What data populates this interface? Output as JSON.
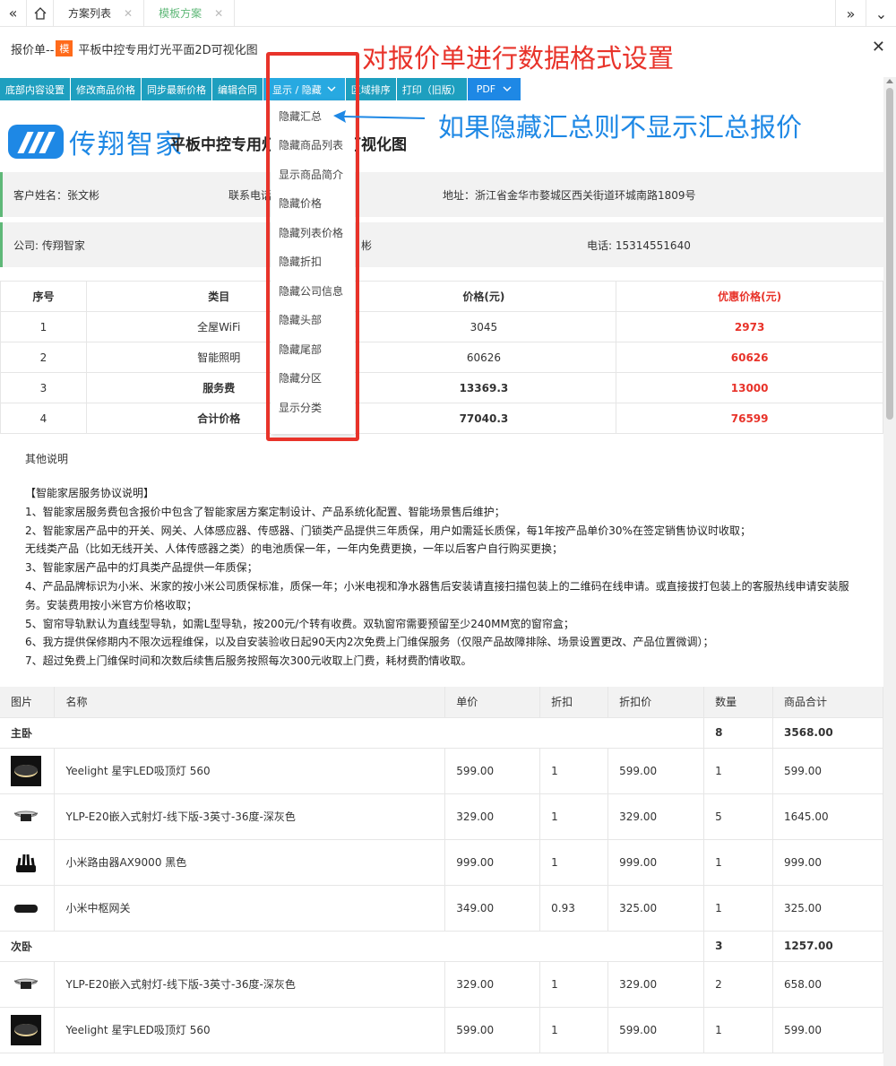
{
  "tabs": [
    {
      "label": "方案列表"
    },
    {
      "label": "模板方案"
    }
  ],
  "header": {
    "prefix": "报价单--",
    "badge": "模",
    "title": "平板中控专用灯光平面2D可视化图"
  },
  "toolbar": {
    "buttons": [
      "底部内容设置",
      "修改商品价格",
      "同步最新价格",
      "编辑合同",
      "显示 / 隐藏",
      "区域排序",
      "打印（旧版）",
      "PDF"
    ]
  },
  "brand": {
    "logo_text": "传翔智家",
    "doc_title": "平板中控专用灯光平面2D可视化图"
  },
  "info": {
    "customer": "客户姓名：张文彬",
    "contact": "联系电话：",
    "address": "地址：浙江省金华市婺城区西关街道环城南路1809号",
    "company": "公司: 传翔智家",
    "staff_suffix": "彬",
    "phone": "电话: 15314551640"
  },
  "summary": {
    "headers": [
      "序号",
      "类目",
      "价格(元)",
      "优惠价格(元)"
    ],
    "rows": [
      [
        "1",
        "全屋WiFi",
        "3045",
        "2973"
      ],
      [
        "2",
        "智能照明",
        "60626",
        "60626"
      ],
      [
        "3",
        "服务费",
        "13369.3",
        "13000"
      ],
      [
        "4",
        "合计价格",
        "77040.3",
        "76599"
      ]
    ]
  },
  "notes": {
    "title": "其他说明",
    "lines": [
      "【智能家居服务协议说明】",
      "1、智能家居服务费包含报价中包含了智能家居方案定制设计、产品系统化配置、智能场景售后维护；",
      "2、智能家居产品中的开关、网关、人体感应器、传感器、门锁类产品提供三年质保，用户如需延长质保，每1年按产品单价30%在签定销售协议时收取；",
      "无线类产品（比如无线开关、人体传感器之类）的电池质保一年，一年内免费更换，一年以后客户自行购买更换；",
      "3、智能家居产品中的灯具类产品提供一年质保；",
      "4、产品品牌标识为小米、米家的按小米公司质保标准，质保一年；小米电视和净水器售后安装请直接扫描包装上的二维码在线申请。或直接拔打包装上的客服热线申请安装服",
      "务。安装费用按小米官方价格收取；",
      "5、窗帘导轨默认为直线型导轨，如需L型导轨，按200元/个转有收费。双轨窗帘需要预留至少240MM宽的窗帘盒；",
      "6、我方提供保修期内不限次远程维保，以及自安装验收日起90天内2次免费上门维保服务（仅限产品故障排除、场景设置更改、产品位置微调）；",
      "7、超过免费上门维保时间和次数后续售后服务按照每次300元收取上门费，耗材费酌情收取。"
    ]
  },
  "products": {
    "headers": [
      "图片",
      "名称",
      "单价",
      "折扣",
      "折扣价",
      "数量",
      "商品合计"
    ],
    "groups": [
      {
        "name": "主卧",
        "qty": "8",
        "total": "3568.00",
        "items": [
          {
            "icon": "ceiling-lamp-icon",
            "name": "Yeelight 星宇LED吸顶灯 560",
            "price": "599.00",
            "discount": "1",
            "dprice": "599.00",
            "qty": "1",
            "total": "599.00"
          },
          {
            "icon": "spotlight-icon",
            "name": "YLP-E20嵌入式射灯-线下版-3英寸-36度-深灰色",
            "price": "329.00",
            "discount": "1",
            "dprice": "329.00",
            "qty": "5",
            "total": "1645.00"
          },
          {
            "icon": "router-icon",
            "name": "小米路由器AX9000 黑色",
            "price": "999.00",
            "discount": "1",
            "dprice": "999.00",
            "qty": "1",
            "total": "999.00"
          },
          {
            "icon": "hub-icon",
            "name": "小米中枢网关",
            "price": "349.00",
            "discount": "0.93",
            "dprice": "325.00",
            "qty": "1",
            "total": "325.00"
          }
        ]
      },
      {
        "name": "次卧",
        "qty": "3",
        "total": "1257.00",
        "items": [
          {
            "icon": "spotlight-icon",
            "name": "YLP-E20嵌入式射灯-线下版-3英寸-36度-深灰色",
            "price": "329.00",
            "discount": "1",
            "dprice": "329.00",
            "qty": "2",
            "total": "658.00"
          },
          {
            "icon": "ceiling-lamp-icon",
            "name": "Yeelight 星宇LED吸顶灯 560",
            "price": "599.00",
            "discount": "1",
            "dprice": "599.00",
            "qty": "1",
            "total": "599.00"
          }
        ]
      }
    ]
  },
  "dropdown": {
    "items": [
      "隐藏汇总",
      "隐藏商品列表",
      "显示商品简介",
      "隐藏价格",
      "隐藏列表价格",
      "隐藏折扣",
      "隐藏公司信息",
      "隐藏头部",
      "隐藏尾部",
      "隐藏分区",
      "显示分类"
    ]
  },
  "annotations": {
    "top": "对报价单进行数据格式设置",
    "side": "如果隐藏汇总则不显示汇总报价"
  },
  "colors": {
    "toolbar": "#1e9fbf",
    "accent_red": "#e8332a",
    "brand_blue": "#1e88e5",
    "active_tab": "#5fb878"
  }
}
